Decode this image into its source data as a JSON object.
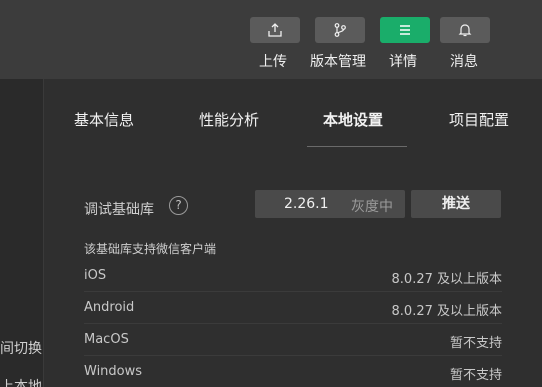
{
  "toolbar": {
    "buttons": [
      {
        "label": "上传",
        "icon": "upload-icon"
      },
      {
        "label": "版本管理",
        "icon": "branch-icon"
      },
      {
        "label": "详情",
        "icon": "menu-icon",
        "active": true
      },
      {
        "label": "消息",
        "icon": "bell-icon"
      }
    ],
    "active_color": "#1aad6a"
  },
  "left_strip": {
    "fragment_1": "间切换",
    "fragment_2": "上本地"
  },
  "tabs": [
    {
      "label": "基本信息"
    },
    {
      "label": "性能分析"
    },
    {
      "label": "本地设置",
      "active": true
    },
    {
      "label": "项目配置"
    }
  ],
  "debug_lib": {
    "label": "调试基础库",
    "help": "?",
    "version": "2.26.1",
    "channel": "灰度中",
    "push_label": "推送"
  },
  "support": {
    "title": "该基础库支持微信客户端",
    "rows": [
      {
        "os": "iOS",
        "value": "8.0.27 及以上版本"
      },
      {
        "os": "Android",
        "value": "8.0.27 及以上版本"
      },
      {
        "os": "MacOS",
        "value": "暂不支持"
      },
      {
        "os": "Windows",
        "value": "暂不支持"
      }
    ]
  }
}
